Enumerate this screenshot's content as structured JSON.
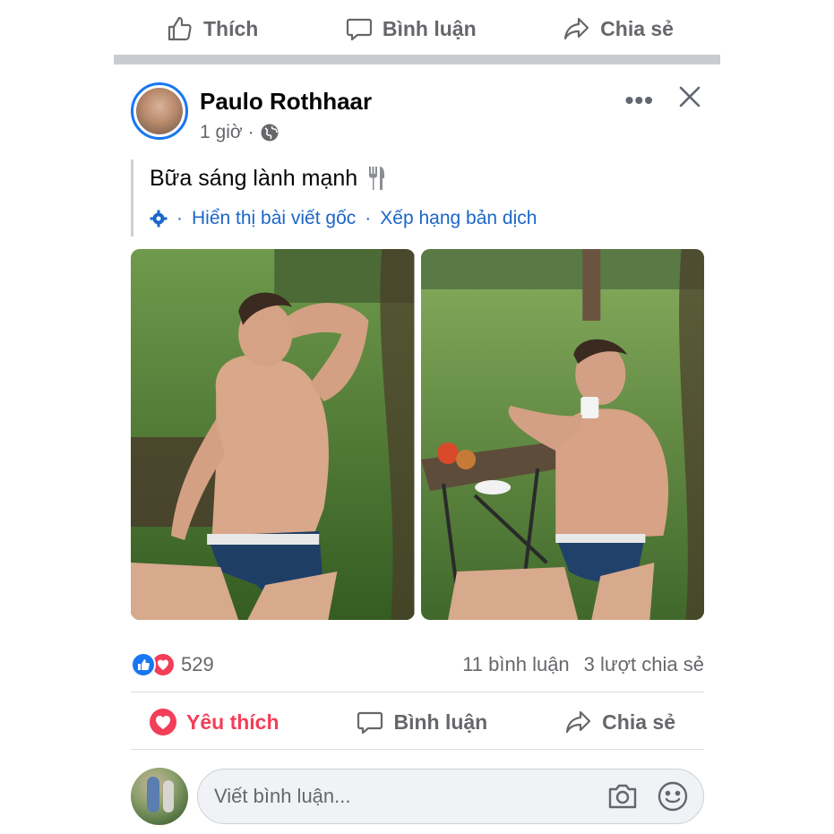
{
  "top_actions": {
    "like": "Thích",
    "comment": "Bình luận",
    "share": "Chia sẻ"
  },
  "post": {
    "author": "Paulo Rothhaar",
    "time": "1 giờ",
    "separator": "·",
    "text": "Bữa sáng lành mạnh",
    "translate": {
      "show_original": "Hiển thị bài viết gốc",
      "dot": "·",
      "rate": "Xếp hạng bản dịch"
    }
  },
  "stats": {
    "reactions": "529",
    "comments": "11 bình luận",
    "shares": "3 lượt chia sẻ"
  },
  "bottom_actions": {
    "like": "Yêu thích",
    "comment": "Bình luận",
    "share": "Chia sẻ"
  },
  "comment_box": {
    "placeholder": "Viết bình luận..."
  },
  "colors": {
    "accent": "#1877f2",
    "love": "#f33e58",
    "link": "#1b66c9",
    "muted": "#65676b"
  },
  "icons": [
    "thumbs-up-icon",
    "comment-bubble-icon",
    "share-arrow-icon",
    "globe-icon",
    "more-icon",
    "close-icon",
    "fork-knife-icon",
    "gear-icon",
    "heart-icon",
    "camera-icon",
    "emoji-icon"
  ]
}
